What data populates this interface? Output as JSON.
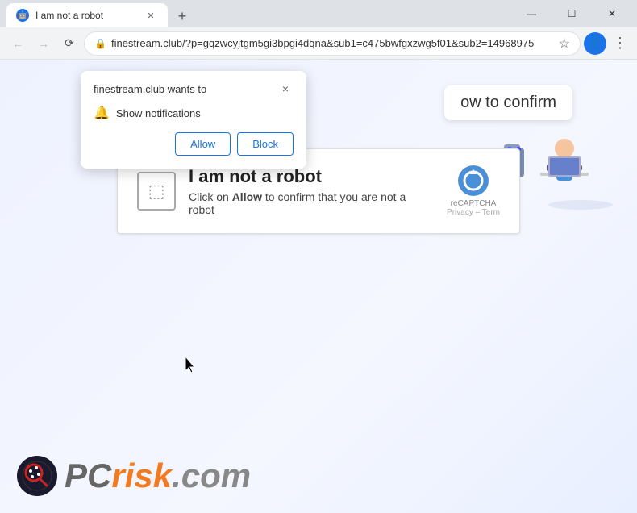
{
  "titlebar": {
    "tab": {
      "title": "I am not a robot",
      "favicon": "🤖"
    },
    "new_tab_label": "+",
    "controls": {
      "minimize": "—",
      "maximize": "☐",
      "close": "✕"
    }
  },
  "omnibox": {
    "url": "finestream.club/?p=gqzwcyjtgm5gi3bpgi4dqna&sub1=c475bwfgxzwg5f01&sub2=14968975",
    "back_title": "Back",
    "forward_title": "Forward",
    "reload_title": "Reload"
  },
  "notification_popup": {
    "site": "finestream.club wants to",
    "permission": "Show notifications",
    "allow_label": "Allow",
    "block_label": "Block",
    "close_label": "×"
  },
  "confirm_text": {
    "prefix": "",
    "highlight": "ow to confirm"
  },
  "robot_card": {
    "title": "I am not a robot",
    "subtitle_prefix": "Click on ",
    "subtitle_allow": "Allow",
    "subtitle_suffix": " to confirm that you are not a robot",
    "recaptcha": "reCAPTCHA",
    "privacy": "Privacy – Term"
  },
  "pcrisk": {
    "pc": "PC",
    "risk": "risk",
    "com": ".com"
  },
  "colors": {
    "accent_blue": "#1a73e8",
    "orange": "#f47a20",
    "gray": "#888888"
  }
}
